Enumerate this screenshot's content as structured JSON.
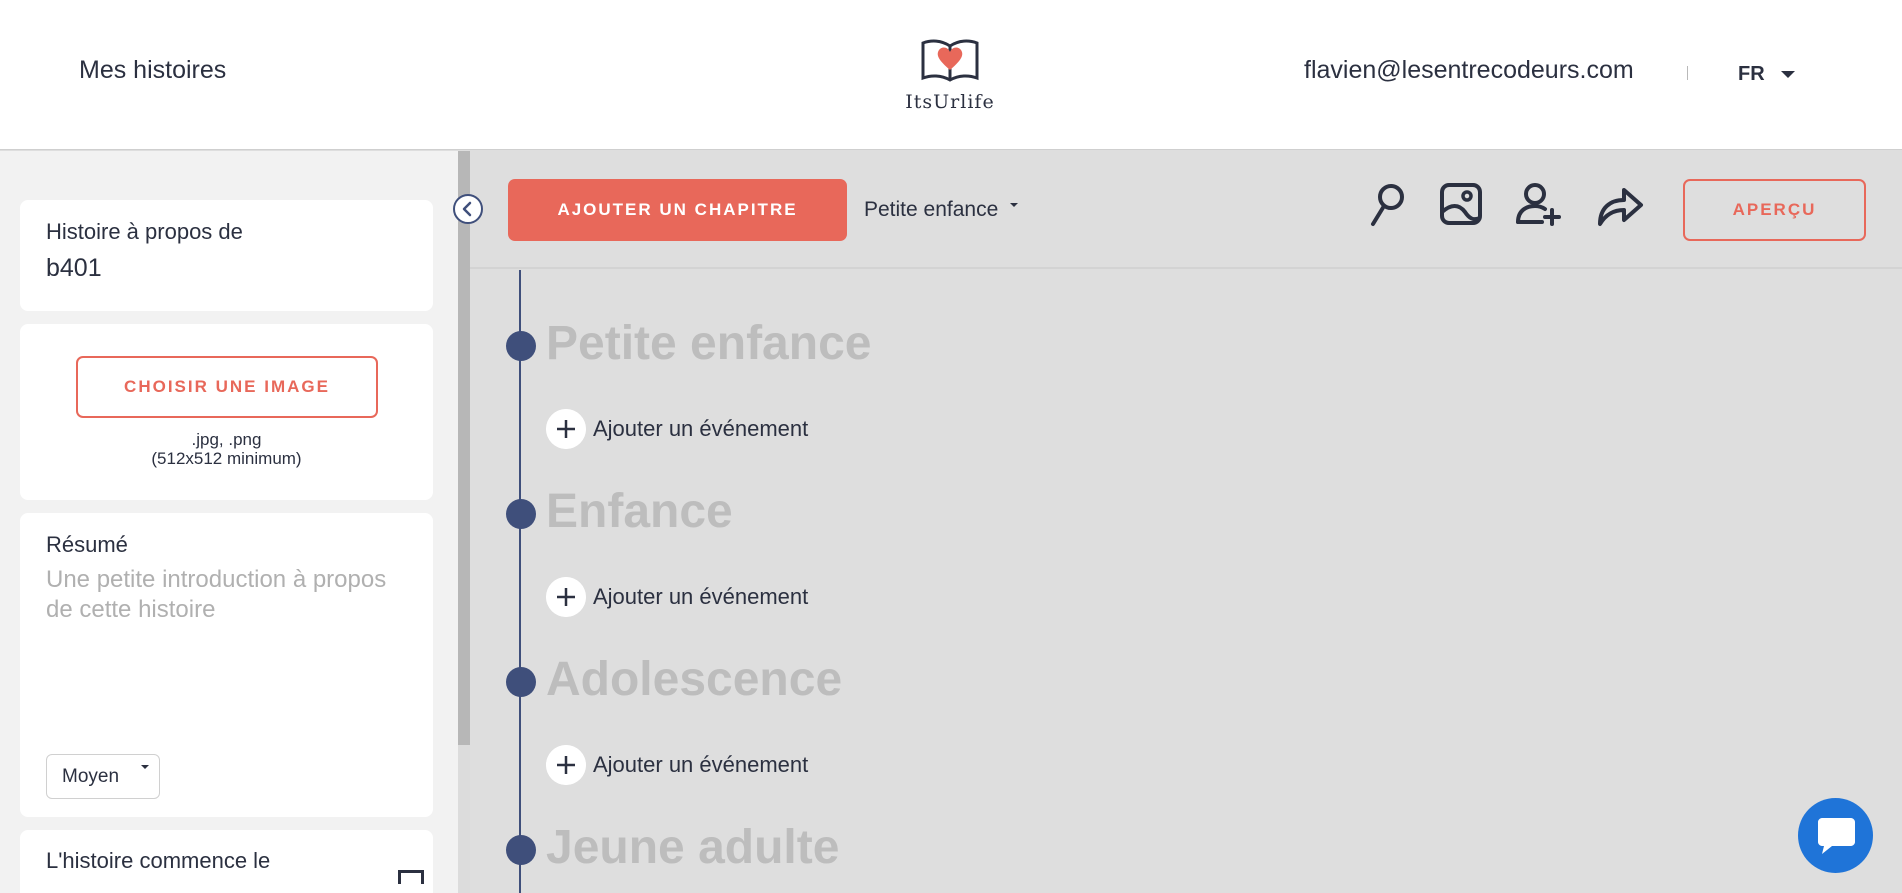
{
  "header": {
    "nav_label": "Mes histoires",
    "logo_text": "ItsUrlife",
    "user_email": "flavien@lesentrecodeurs.com",
    "language": "FR"
  },
  "sidebar": {
    "about": {
      "label": "Histoire à propos de",
      "value": "b401"
    },
    "image": {
      "button_label": "CHOISIR UNE IMAGE",
      "hint_formats": ".jpg, .png",
      "hint_size": "(512x512 minimum)"
    },
    "summary": {
      "label": "Résumé",
      "placeholder": "Une petite introduction à propos de cette histoire",
      "size_value": "Moyen"
    },
    "start_date": {
      "label": "L'histoire commence le"
    }
  },
  "toolbar": {
    "add_chapter_label": "AJOUTER UN CHAPITRE",
    "chapter_select_value": "Petite enfance",
    "preview_label": "APERÇU"
  },
  "timeline": {
    "add_event_label": "Ajouter un événement",
    "chapters": [
      "Petite enfance",
      "Enfance",
      "Adolescence",
      "Jeune adulte"
    ]
  },
  "colors": {
    "accent": "#e8685a",
    "timeline": "#3f4f7b",
    "chat": "#1f74d8"
  },
  "icons": [
    "search-icon",
    "image-icon",
    "add-user-icon",
    "share-icon",
    "chat-icon",
    "calendar-icon",
    "chevron-left-icon"
  ]
}
